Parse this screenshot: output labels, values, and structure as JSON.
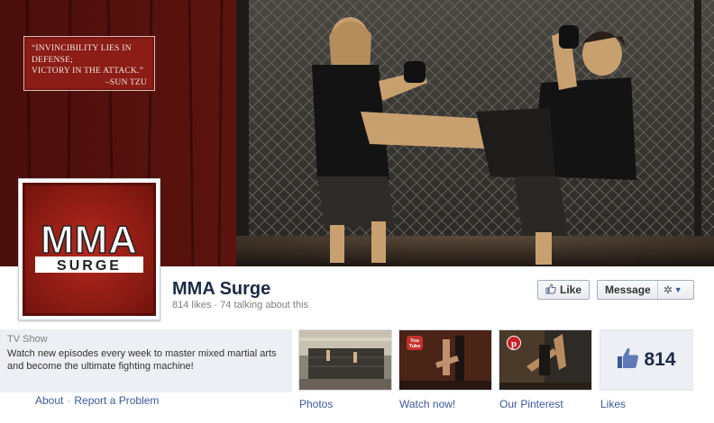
{
  "cover": {
    "quote_line1": "“INVINCIBILITY LIES IN DEFENSE;",
    "quote_line2": "VICTORY IN THE ATTACK.”",
    "quote_line3": "–SUN TZU"
  },
  "profile": {
    "logo_top": "MMA",
    "logo_bottom": "SURGE",
    "name": "MMA Surge",
    "stats": "814 likes · 74 talking about this"
  },
  "actions": {
    "like_label": "Like",
    "message_label": "Message"
  },
  "about": {
    "category": "TV Show",
    "description": "Watch new episodes every week to master mixed martial arts and become the ultimate fighting machine!",
    "link_about": "About",
    "link_separator": "·",
    "link_report": "Report a Problem"
  },
  "apps": [
    {
      "label": "Photos",
      "icon": "photo-thumbnail"
    },
    {
      "label": "Watch now!",
      "icon": "youtube-icon",
      "badge": "You Tube"
    },
    {
      "label": "Our Pinterest",
      "icon": "pinterest-icon"
    }
  ],
  "likes_box": {
    "count": "814",
    "label": "Likes"
  },
  "colors": {
    "brand_blue": "#3b5998",
    "name_navy": "#1c2a47",
    "logo_red": "#a3221a",
    "panel_gray": "#edeff4"
  }
}
